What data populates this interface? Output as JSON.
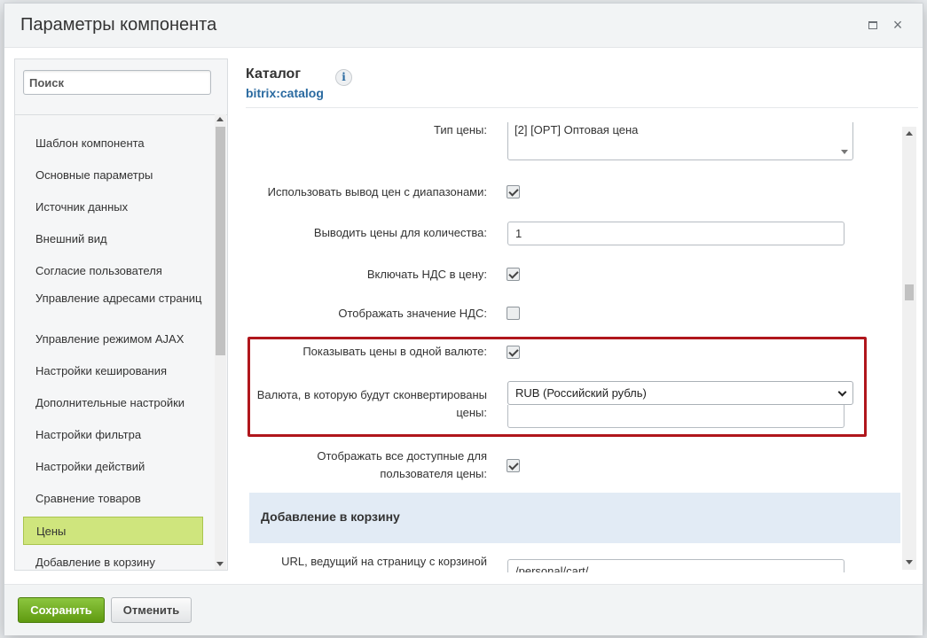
{
  "dialog": {
    "title": "Параметры компонента"
  },
  "sidebar": {
    "search_placeholder": "Поиск",
    "items": [
      {
        "label": "Шаблон компонента"
      },
      {
        "label": "Основные параметры"
      },
      {
        "label": "Источник данных"
      },
      {
        "label": "Внешний вид"
      },
      {
        "label": "Согласие пользователя"
      },
      {
        "label": "Управление адресами страниц"
      },
      {
        "label": "Управление режимом AJAX"
      },
      {
        "label": "Настройки кеширования"
      },
      {
        "label": "Дополнительные настройки"
      },
      {
        "label": "Настройки фильтра"
      },
      {
        "label": "Настройки действий"
      },
      {
        "label": "Сравнение товаров"
      },
      {
        "label": "Цены",
        "active": true
      },
      {
        "label": "Добавление в корзину"
      }
    ]
  },
  "content": {
    "title": "Каталог",
    "subtitle": "bitrix:catalog",
    "info_icon": "info-icon"
  },
  "form": {
    "price_type": {
      "label": "Тип цены:",
      "value": "[2] [OPT] Оптовая цена"
    },
    "use_price_ranges": {
      "label": "Использовать вывод цен с диапазонами:",
      "checked": true
    },
    "price_quantity": {
      "label": "Выводить цены для количества:",
      "value": "1"
    },
    "include_vat": {
      "label": "Включать НДС в цену:",
      "checked": true
    },
    "show_vat_value": {
      "label": "Отображать значение НДС:",
      "checked": false
    },
    "single_currency": {
      "label": "Показывать цены в одной валюте:",
      "checked": true
    },
    "target_currency": {
      "label_line1": "Валюта, в которую будут сконвертированы",
      "label_line2": "цены:",
      "value": "RUB (Российский рубль)",
      "extra_value": ""
    },
    "show_all_prices": {
      "label_line1": "Отображать все доступные для",
      "label_line2": "пользователя цены:",
      "checked": true
    },
    "basket_section": {
      "title": "Добавление в корзину"
    },
    "basket_url": {
      "label": "URL, ведущий на страницу с корзиной",
      "value": "/personal/cart/"
    }
  },
  "footer": {
    "save_label": "Сохранить",
    "cancel_label": "Отменить"
  },
  "colors": {
    "active_item_bg": "#cfe57d",
    "highlight_border": "#b0161c",
    "save_button": "#6aa81c",
    "section_bg": "#e2ebf5",
    "link_color": "#2a6aa0"
  }
}
